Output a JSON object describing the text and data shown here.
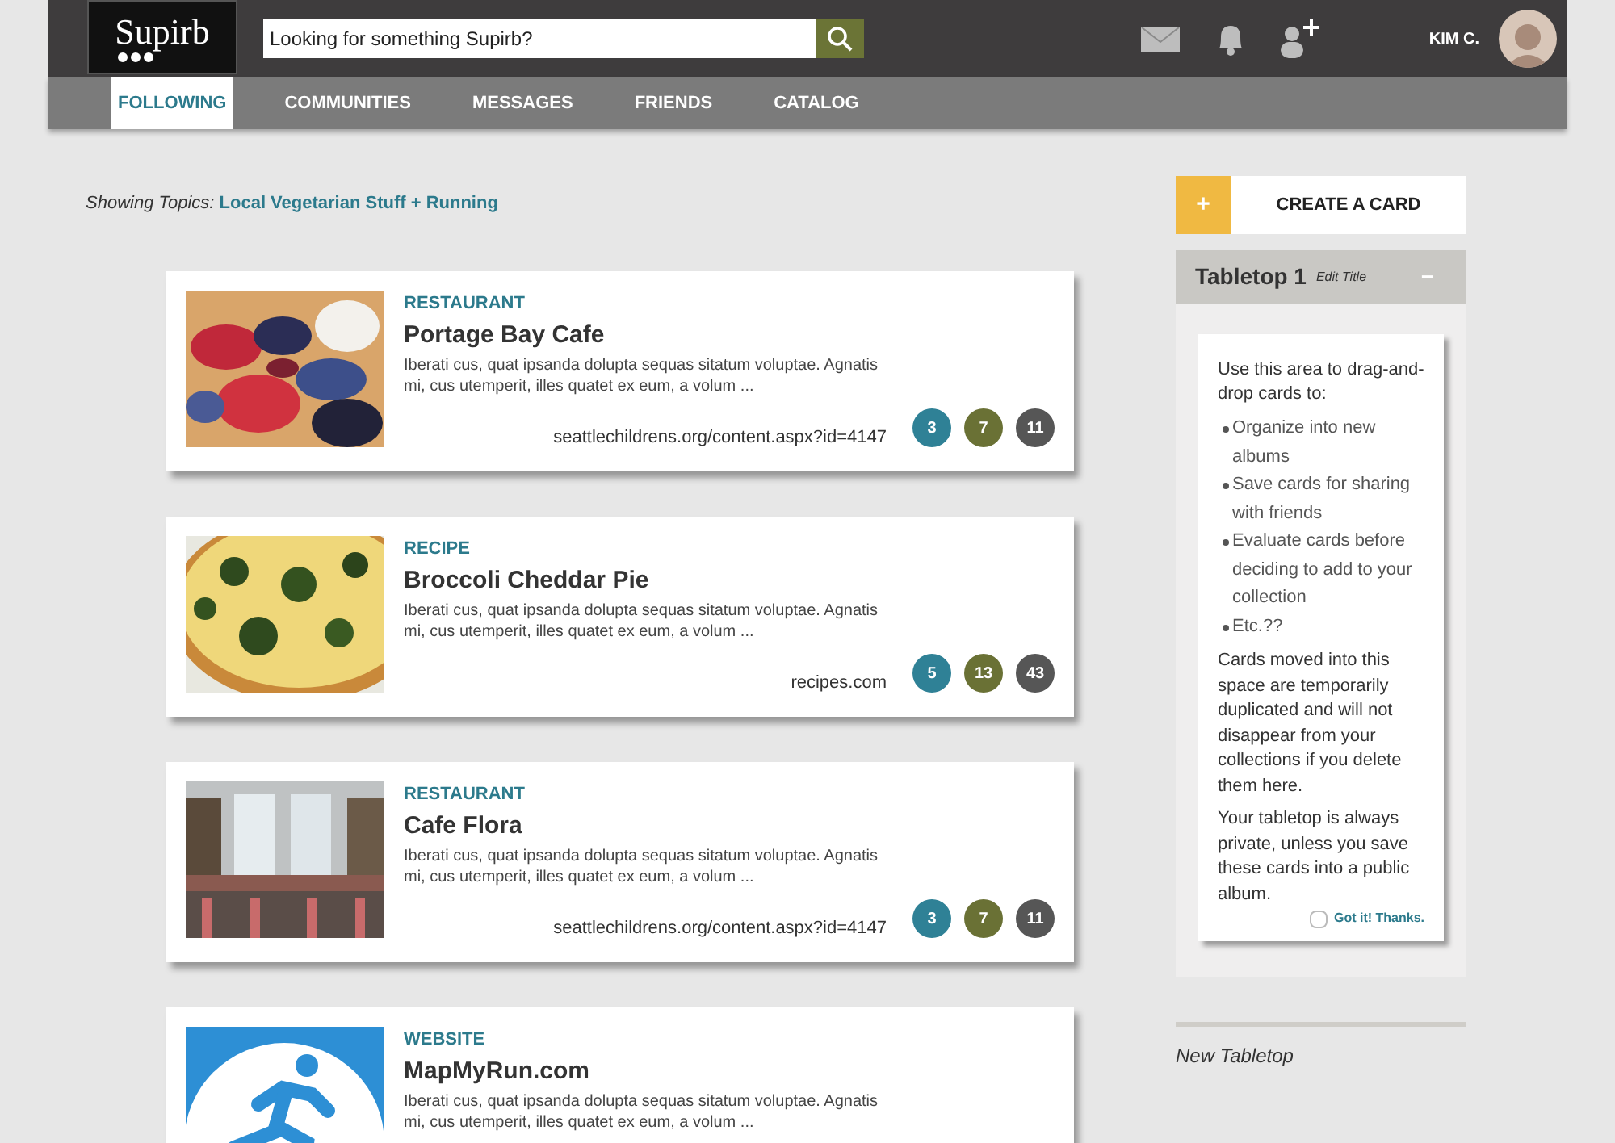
{
  "header": {
    "logo": "Supirb",
    "search": {
      "placeholder": "Looking for something Supirb?"
    },
    "user": "KIM C."
  },
  "nav": [
    {
      "label": "FOLLOWING",
      "selected": true
    },
    {
      "label": "COMMUNITIES",
      "selected": false
    },
    {
      "label": "MESSAGES",
      "selected": false
    },
    {
      "label": "FRIENDS",
      "selected": false
    },
    {
      "label": "CATALOG",
      "selected": false
    }
  ],
  "topics": {
    "label": "Showing Topics:",
    "value": "Local Vegetarian Stuff + Running"
  },
  "cards": [
    {
      "category": "RESTAURANT",
      "title": "Portage Bay Cafe",
      "description": "Iberati cus, quat ipsanda dolupta sequas sitatum voluptae. Agnatis mi, cus utemperit, illes quatet ex eum, a volum ...",
      "url": "seattlechildrens.org/content.aspx?id=4147",
      "counts": [
        {
          "value": "3",
          "color": "#2f8196"
        },
        {
          "value": "7",
          "color": "#6a7135"
        },
        {
          "value": "11",
          "color": "#565656"
        }
      ]
    },
    {
      "category": "RECIPE",
      "title": "Broccoli Cheddar Pie",
      "description": "Iberati cus, quat ipsanda dolupta sequas sitatum voluptae. Agnatis mi, cus utemperit, illes quatet ex eum, a volum ...",
      "url": "recipes.com",
      "counts": [
        {
          "value": "5",
          "color": "#2f8196"
        },
        {
          "value": "13",
          "color": "#6a7135"
        },
        {
          "value": "43",
          "color": "#565656"
        }
      ]
    },
    {
      "category": "RESTAURANT",
      "title": "Cafe Flora",
      "description": "Iberati cus, quat ipsanda dolupta sequas sitatum voluptae. Agnatis mi, cus utemperit, illes quatet ex eum, a volum ...",
      "url": "seattlechildrens.org/content.aspx?id=4147",
      "counts": [
        {
          "value": "3",
          "color": "#2f8196"
        },
        {
          "value": "7",
          "color": "#6a7135"
        },
        {
          "value": "11",
          "color": "#565656"
        }
      ]
    },
    {
      "category": "WEBSITE",
      "title": "MapMyRun.com",
      "description": "Iberati cus, quat ipsanda dolupta sequas sitatum voluptae. Agnatis mi, cus utemperit, illes quatet ex eum, a volum ..."
    }
  ],
  "sidebar": {
    "create": {
      "icon": "+",
      "label": "CREATE A CARD"
    },
    "tabletop": {
      "title": "Tabletop 1",
      "edit": "Edit Title",
      "collapse": "−",
      "intro": "Use this area to drag-and-drop cards to:",
      "bullets": [
        "Organize into new albums",
        "Save cards for sharing with friends",
        "Evaluate cards before deciding to add to your collection",
        "Etc.??"
      ],
      "paragraphs": [
        "Cards moved into this space are temporarily duplicated and will not disappear from your collections if you delete them here.",
        "Your tabletop is always private, unless you save these cards into a public album."
      ],
      "dismiss": {
        "label": "Got it! Thanks.",
        "checked": false
      }
    },
    "new_tabletop": "New Tabletop"
  }
}
